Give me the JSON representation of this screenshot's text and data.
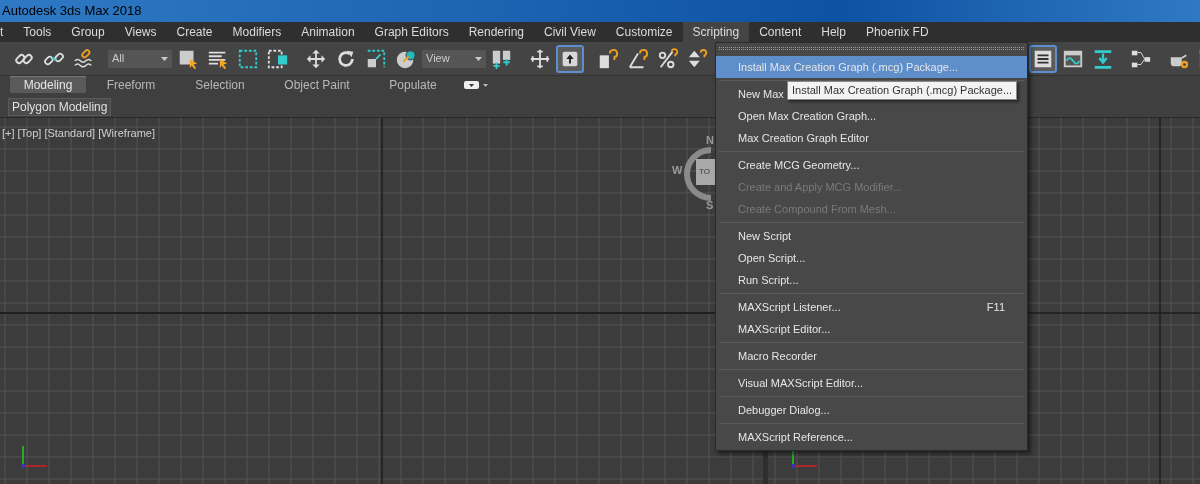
{
  "window": {
    "title": "Autodesk 3ds Max 2018"
  },
  "menu_bar": [
    {
      "label": "t",
      "selected": false
    },
    {
      "label": "Tools",
      "selected": false
    },
    {
      "label": "Group",
      "selected": false
    },
    {
      "label": "Views",
      "selected": false
    },
    {
      "label": "Create",
      "selected": false
    },
    {
      "label": "Modifiers",
      "selected": false
    },
    {
      "label": "Animation",
      "selected": false
    },
    {
      "label": "Graph Editors",
      "selected": false
    },
    {
      "label": "Rendering",
      "selected": false
    },
    {
      "label": "Civil View",
      "selected": false
    },
    {
      "label": "Customize",
      "selected": false
    },
    {
      "label": "Scripting",
      "selected": true
    },
    {
      "label": "Content",
      "selected": false
    },
    {
      "label": "Help",
      "selected": false
    },
    {
      "label": "Phoenix FD",
      "selected": false
    }
  ],
  "toolbar": {
    "dropdowns": [
      "All",
      "View"
    ],
    "toggles": [
      {
        "on": true
      },
      {
        "on": true
      }
    ]
  },
  "ribbon": {
    "tabs": [
      {
        "label": "Modeling",
        "selected": true
      },
      {
        "label": "Freeform",
        "selected": false
      },
      {
        "label": "Selection",
        "selected": false
      },
      {
        "label": "Object Paint",
        "selected": false
      },
      {
        "label": "Populate",
        "selected": false
      }
    ],
    "panel": "Polygon Modeling"
  },
  "viewport": {
    "labels": [
      "[+]",
      "[Top]",
      "[Standard]",
      "[Wireframe]"
    ],
    "viewcube": {
      "face": "TO",
      "directions": [
        "N",
        "W",
        "S"
      ]
    }
  },
  "scripting_menu": [
    {
      "kind": "item",
      "label": "Install Max Creation Graph (.mcg) Package...",
      "selected": true,
      "disabled": false
    },
    {
      "kind": "separator"
    },
    {
      "kind": "item",
      "label": "New Max",
      "selected": false,
      "disabled": false
    },
    {
      "kind": "item",
      "label": "Open Max Creation Graph...",
      "selected": false,
      "disabled": false
    },
    {
      "kind": "item",
      "label": "Max Creation Graph Editor",
      "selected": false,
      "disabled": false
    },
    {
      "kind": "separator"
    },
    {
      "kind": "item",
      "label": "Create MCG Geometry...",
      "selected": false,
      "disabled": false
    },
    {
      "kind": "item",
      "label": "Create and Apply MCG Modifier...",
      "selected": false,
      "disabled": true
    },
    {
      "kind": "item",
      "label": "Create Compound From Mesh...",
      "selected": false,
      "disabled": true
    },
    {
      "kind": "separator"
    },
    {
      "kind": "item",
      "label": "New Script",
      "selected": false,
      "disabled": false
    },
    {
      "kind": "item",
      "label": "Open Script...",
      "selected": false,
      "disabled": false
    },
    {
      "kind": "item",
      "label": "Run Script...",
      "selected": false,
      "disabled": false
    },
    {
      "kind": "separator"
    },
    {
      "kind": "item",
      "label": "MAXScript Listener...",
      "shortcut": "F11",
      "selected": false,
      "disabled": false
    },
    {
      "kind": "item",
      "label": "MAXScript Editor...",
      "selected": false,
      "disabled": false
    },
    {
      "kind": "separator"
    },
    {
      "kind": "item",
      "label": "Macro Recorder",
      "selected": false,
      "disabled": false
    },
    {
      "kind": "separator"
    },
    {
      "kind": "item",
      "label": "Visual MAXScript Editor...",
      "selected": false,
      "disabled": false
    },
    {
      "kind": "separator"
    },
    {
      "kind": "item",
      "label": "Debugger Dialog...",
      "selected": false,
      "disabled": false
    },
    {
      "kind": "separator"
    },
    {
      "kind": "item",
      "label": "MAXScript Reference...",
      "selected": false,
      "disabled": false
    }
  ],
  "tooltip": "Install Max Creation Graph (.mcg) Package..."
}
